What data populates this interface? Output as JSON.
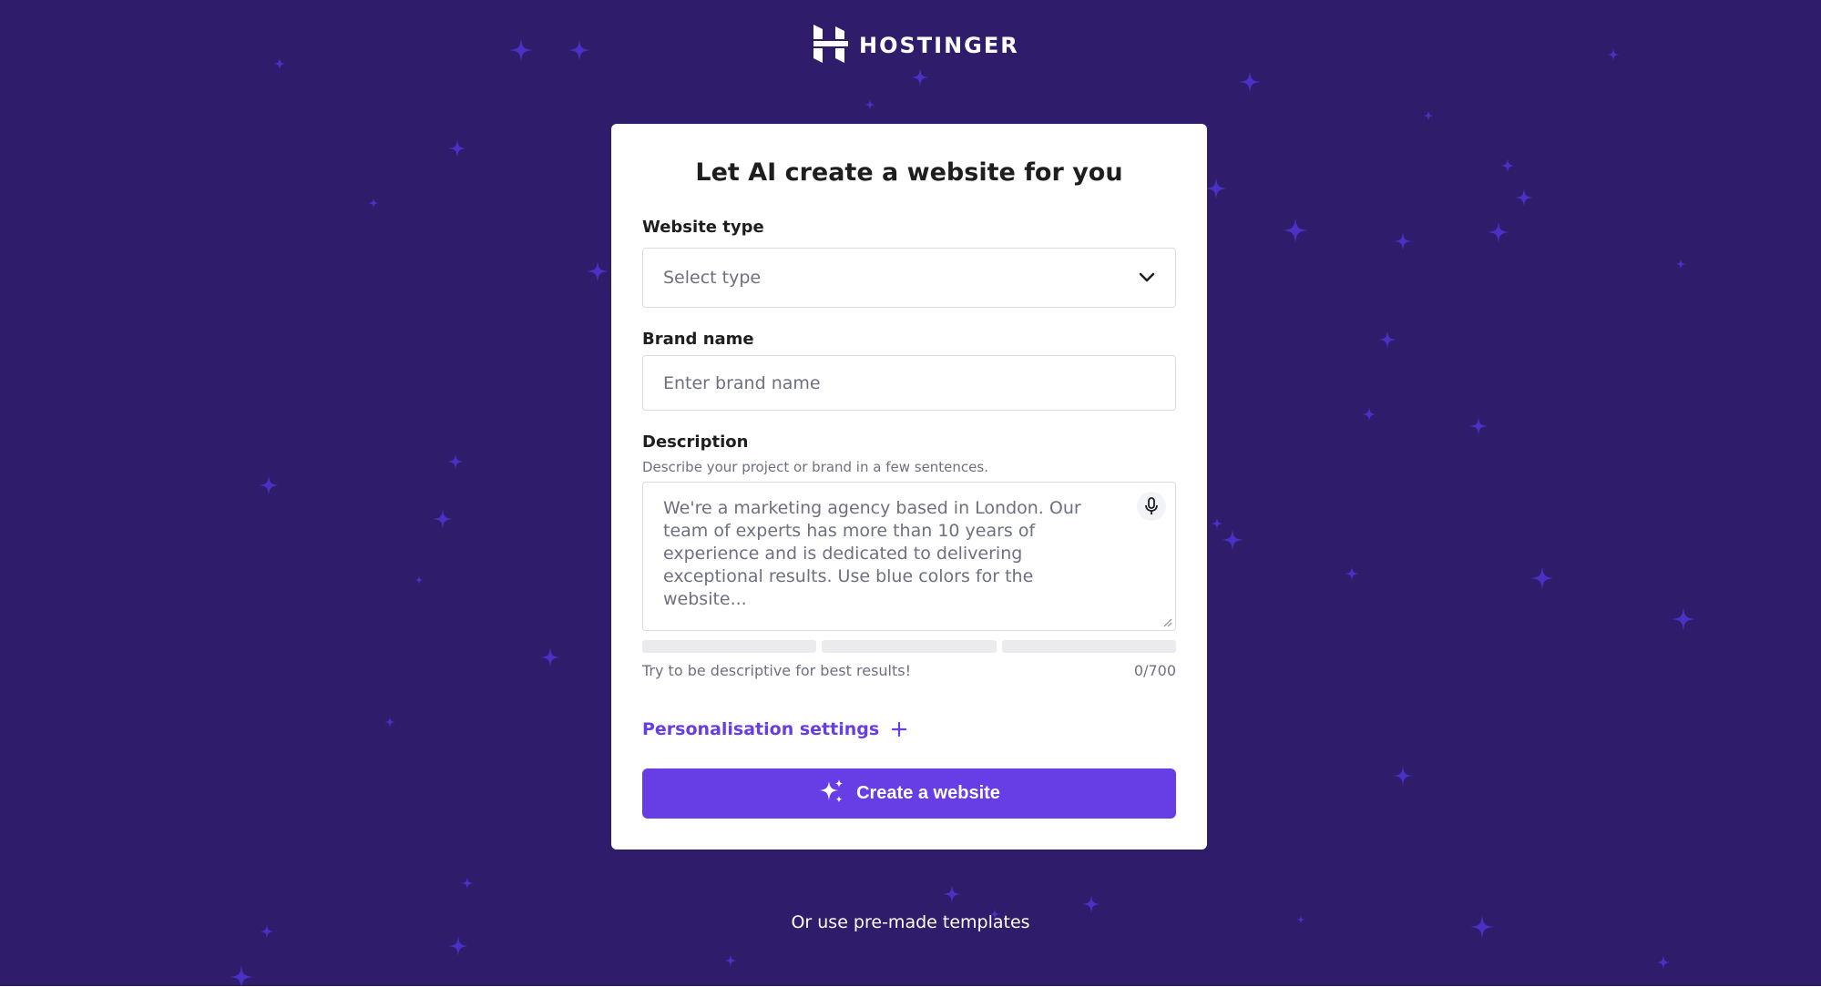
{
  "brand": {
    "name": "HOSTINGER",
    "logo_icon": "hostinger-h-logo"
  },
  "colors": {
    "background": "#2f1c6a",
    "accent": "#673de6",
    "star": "#4a2fc4"
  },
  "card": {
    "title": "Let AI create a website for you",
    "website_type": {
      "label": "Website type",
      "placeholder": "Select type",
      "icon": "chevron-down-icon"
    },
    "brand_name": {
      "label": "Brand name",
      "placeholder": "Enter brand name"
    },
    "description": {
      "label": "Description",
      "hint": "Describe your project or brand in a few sentences.",
      "placeholder": "We're a marketing agency based in London. Our team of experts has more than 10 years of experience and is dedicated to delivering exceptional results. Use blue colors for the website...",
      "icon": "microphone-icon",
      "helper": "Try to be descriptive for best results!",
      "counter": "0/700"
    },
    "personalisation": {
      "label": "Personalisation settings",
      "icon": "plus-icon"
    },
    "create_button": {
      "label": "Create a website",
      "icon": "sparkles-icon"
    }
  },
  "footer": {
    "link": "Or use pre-made templates"
  }
}
